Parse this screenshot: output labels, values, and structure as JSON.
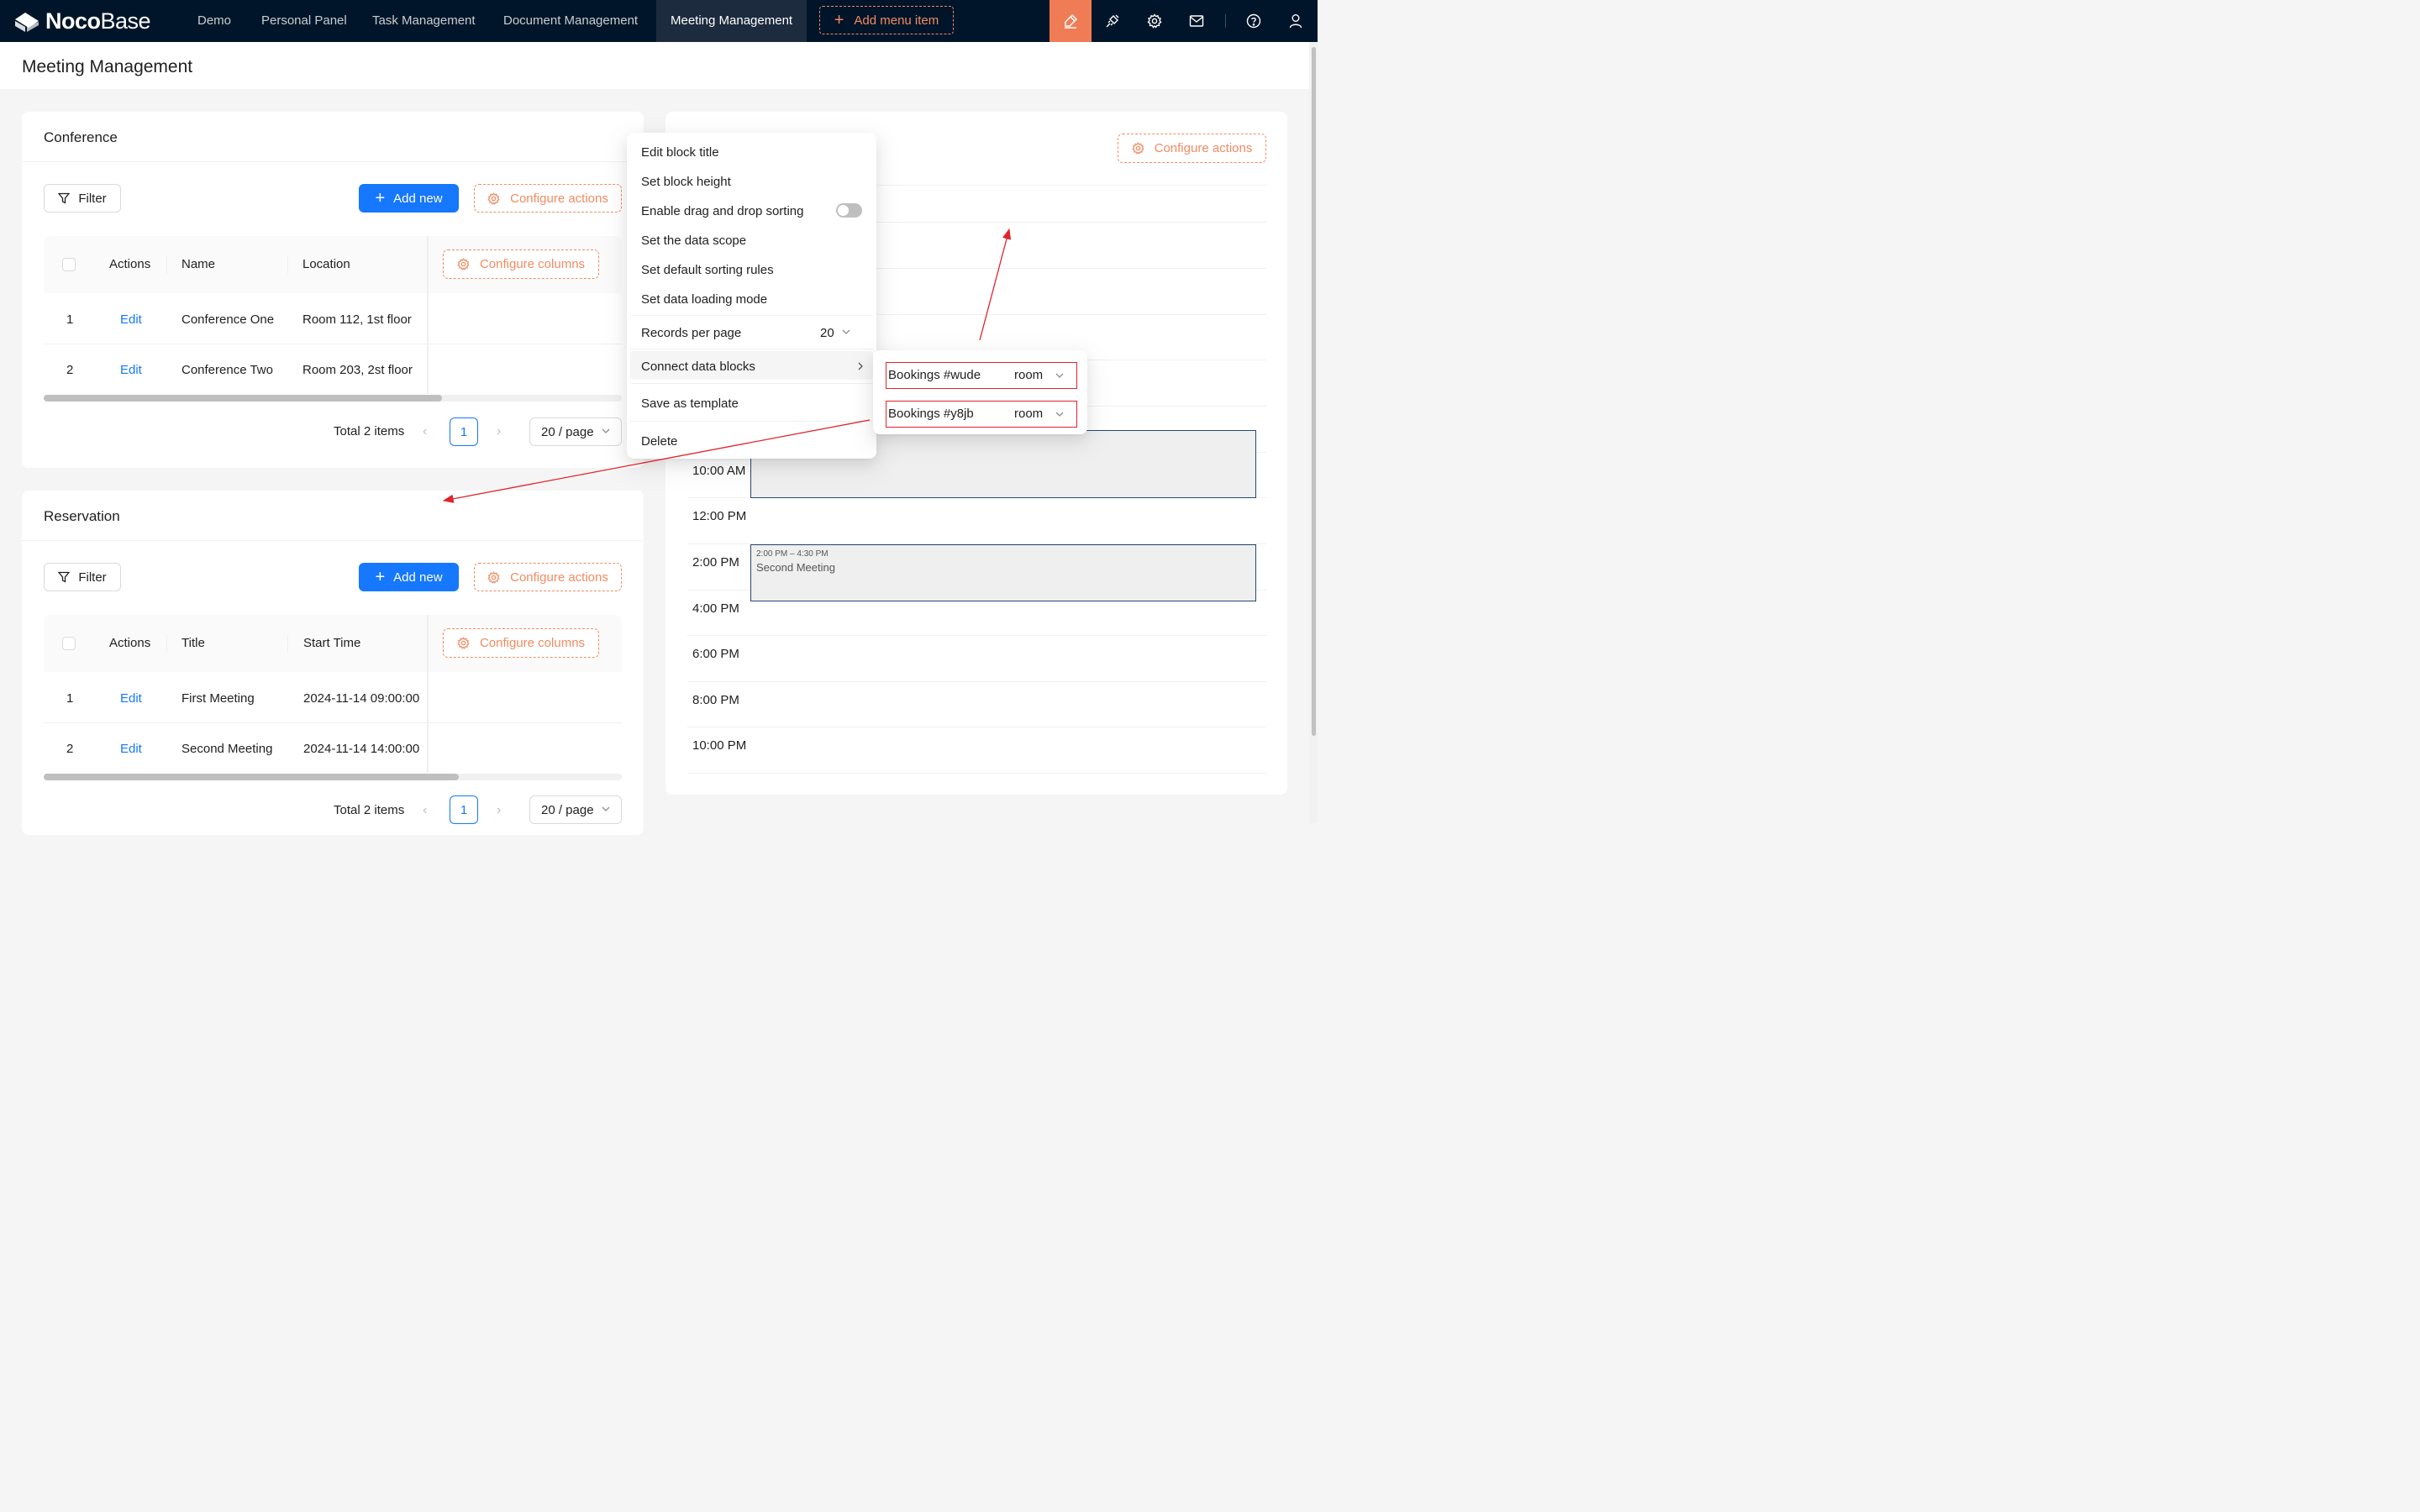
{
  "app": {
    "logo_bold": "Noco",
    "logo_light": "Base"
  },
  "nav": {
    "items": [
      "Demo",
      "Personal Panel",
      "Task Management",
      "Document Management",
      "Meeting Management"
    ],
    "active": "Meeting Management",
    "add_menu_label": "Add menu item"
  },
  "toolbar_icons": [
    "ui-editor-icon",
    "plugin-manager-icon",
    "settings-icon",
    "mail-icon",
    "help-icon",
    "user-icon"
  ],
  "colors": {
    "accent_orange": "#f18b62",
    "primary_blue": "#1677ff",
    "topbar": "#001529",
    "annotation_red": "#e0242b"
  },
  "page": {
    "title": "Meeting Management"
  },
  "conference": {
    "title": "Conference",
    "filter_label": "Filter",
    "add_new_label": "Add new",
    "configure_actions_label": "Configure actions",
    "configure_columns_label": "Configure columns",
    "columns": [
      "Actions",
      "Name",
      "Location"
    ],
    "rows": [
      {
        "index": "1",
        "action": "Edit",
        "name": "Conference One",
        "location": "Room 112, 1st floor"
      },
      {
        "index": "2",
        "action": "Edit",
        "name": "Conference Two",
        "location": "Room 203, 2st floor"
      }
    ],
    "pagination": {
      "total": "Total 2 items",
      "page": "1",
      "size": "20 / page"
    }
  },
  "reservation": {
    "title": "Reservation",
    "filter_label": "Filter",
    "add_new_label": "Add new",
    "configure_actions_label": "Configure actions",
    "configure_columns_label": "Configure columns",
    "columns": [
      "Actions",
      "Title",
      "Start Time"
    ],
    "rows": [
      {
        "index": "1",
        "action": "Edit",
        "title": "First Meeting",
        "start": "2024-11-14 09:00:00"
      },
      {
        "index": "2",
        "action": "Edit",
        "title": "Second Meeting",
        "start": "2024-11-14 14:00:00"
      }
    ],
    "pagination": {
      "total": "Total 2 items",
      "page": "1",
      "size": "20 / page"
    }
  },
  "calendar": {
    "configure_actions_label": "Configure actions",
    "time_labels": [
      "10:00 AM",
      "12:00 PM",
      "2:00 PM",
      "4:00 PM",
      "6:00 PM",
      "8:00 PM",
      "10:00 PM"
    ],
    "events": [
      {
        "time": "",
        "title": ""
      },
      {
        "time": "2:00 PM – 4:30 PM",
        "title": "Second Meeting"
      }
    ]
  },
  "block_menu": {
    "items": {
      "edit_title": "Edit block title",
      "set_height": "Set block height",
      "drag_sort": "Enable drag and drop sorting",
      "data_scope": "Set the data scope",
      "sorting": "Set default sorting rules",
      "loading_mode": "Set data loading mode",
      "records_per_page": "Records per page",
      "records_value": "20",
      "connect_blocks": "Connect data blocks",
      "save_template": "Save as template",
      "delete": "Delete"
    },
    "drag_sort_enabled": false
  },
  "connect_submenu": {
    "items": [
      {
        "label": "Bookings #wude",
        "field": "room"
      },
      {
        "label": "Bookings #y8jb",
        "field": "room"
      }
    ]
  }
}
